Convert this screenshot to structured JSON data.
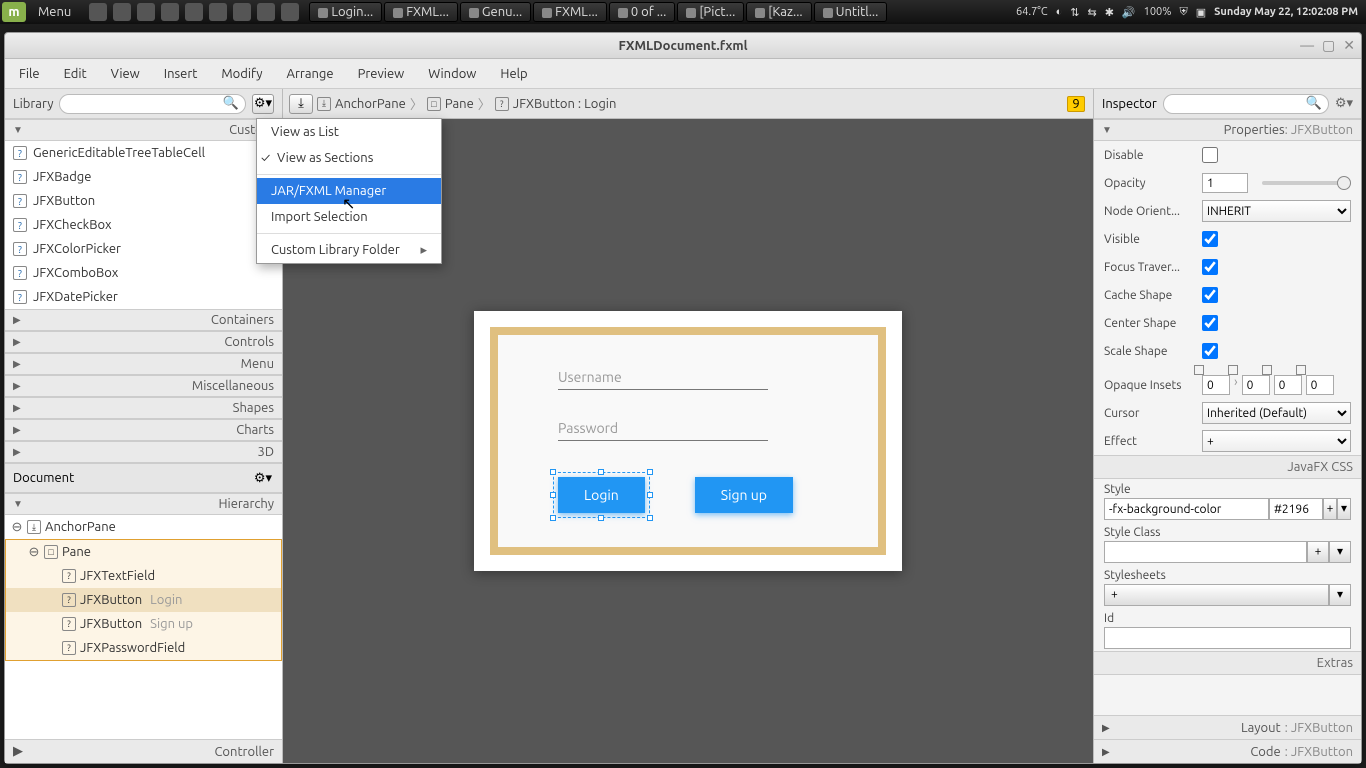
{
  "taskbar": {
    "menu": "Menu",
    "tasks": [
      "Login...",
      "FXML...",
      "Genu...",
      "FXML...",
      "0 of ...",
      "[Pict...",
      "[Kaz...",
      "Untitl..."
    ],
    "temp": "64.7°C",
    "battery": "100%",
    "clock": "Sunday May 22, 12:02:08 PM"
  },
  "window": {
    "title": "FXMLDocument.fxml"
  },
  "menubar": [
    "File",
    "Edit",
    "View",
    "Insert",
    "Modify",
    "Arrange",
    "Preview",
    "Window",
    "Help"
  ],
  "library": {
    "title": "Library",
    "firstSection": "Custom",
    "items": [
      "GenericEditableTreeTableCell",
      "JFXBadge",
      "JFXButton",
      "JFXCheckBox",
      "JFXColorPicker",
      "JFXComboBox",
      "JFXDatePicker"
    ],
    "sections": [
      "Containers",
      "Controls",
      "Menu",
      "Miscellaneous",
      "Shapes",
      "Charts",
      "3D"
    ]
  },
  "document": {
    "title": "Document",
    "hierarchy": "Hierarchy",
    "controller": "Controller",
    "tree": {
      "root": "AnchorPane",
      "pane": "Pane",
      "children": [
        {
          "t": "JFXTextField",
          "s": ""
        },
        {
          "t": "JFXButton",
          "s": "Login",
          "sel": true
        },
        {
          "t": "JFXButton",
          "s": "Sign up"
        },
        {
          "t": "JFXPasswordField",
          "s": ""
        }
      ]
    }
  },
  "breadcrumb": [
    {
      "ic": "⤓",
      "t": "AnchorPane"
    },
    {
      "ic": "□",
      "t": "Pane"
    },
    {
      "ic": "?",
      "t": "JFXButton : Login"
    }
  ],
  "warn": "9",
  "form": {
    "username_ph": "Username",
    "password_ph": "Password",
    "login": "Login",
    "signup": "Sign up"
  },
  "inspector": {
    "title": "Inspector",
    "propsHeader": "Properties",
    "propsType": ": JFXButton",
    "labels": {
      "disable": "Disable",
      "opacity": "Opacity",
      "node": "Node Orient...",
      "visible": "Visible",
      "focus": "Focus Traver...",
      "cache": "Cache Shape",
      "center": "Center Shape",
      "scale": "Scale Shape",
      "insets": "Opaque Insets",
      "cursor": "Cursor",
      "effect": "Effect",
      "css": "JavaFX CSS",
      "style": "Style",
      "styleClass": "Style Class",
      "stylesheets": "Stylesheets",
      "id": "Id",
      "extras": "Extras",
      "layout": "Layout",
      "code": "Code"
    },
    "values": {
      "opacity": "1",
      "node": "INHERIT",
      "inset": "0",
      "cursor": "Inherited (Default)",
      "effect": "+",
      "style_a": "-fx-background-color",
      "style_b": "#2196"
    }
  },
  "popup": {
    "viewList": "View as List",
    "viewSections": "View as Sections",
    "jar": "JAR/FXML Manager",
    "import": "Import Selection",
    "custom": "Custom Library Folder"
  }
}
